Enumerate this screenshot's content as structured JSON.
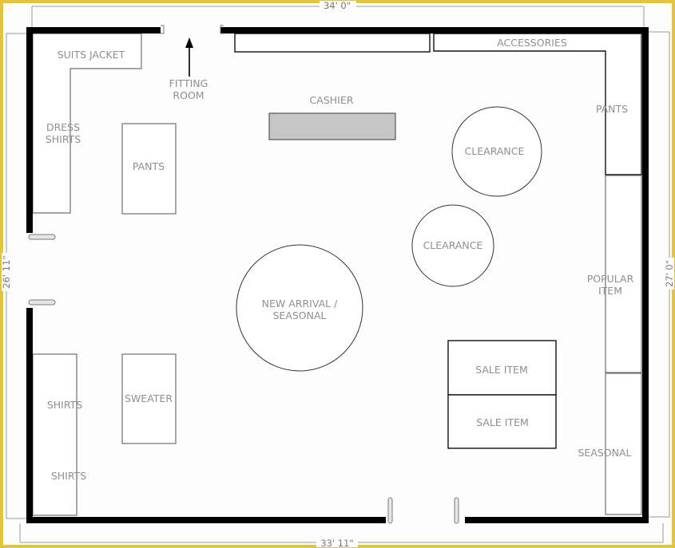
{
  "dimensions": {
    "top": "34' 0\"",
    "bottom": "33' 11\"",
    "left": "26' 11\"",
    "right": "27' 0\""
  },
  "fixtures": {
    "suits_jacket": "SUITS JACKET",
    "fitting_room_line1": "FITTING",
    "fitting_room_line2": "ROOM",
    "dress_shirts_line1": "DRESS",
    "dress_shirts_line2": "SHIRTS",
    "pants_left": "PANTS",
    "cashier": "CASHIER",
    "accessories": "ACCESSORIES",
    "pants_right": "PANTS",
    "clearance_top": "CLEARANCE",
    "clearance_bottom": "CLEARANCE",
    "new_arrival_line1": "NEW ARRIVAL /",
    "new_arrival_line2": "SEASONAL",
    "popular_item_line1": "POPULAR",
    "popular_item_line2": "ITEM",
    "sale_item_1": "SALE ITEM",
    "sale_item_2": "SALE ITEM",
    "seasonal": "SEASONAL",
    "shirts_1": "SHIRTS",
    "shirts_2": "SHIRTS",
    "sweater": "SWEATER"
  },
  "colors": {
    "frame_border": "#e3c53a",
    "wall": "#000000",
    "cashier_fill": "#c6c6c6"
  }
}
